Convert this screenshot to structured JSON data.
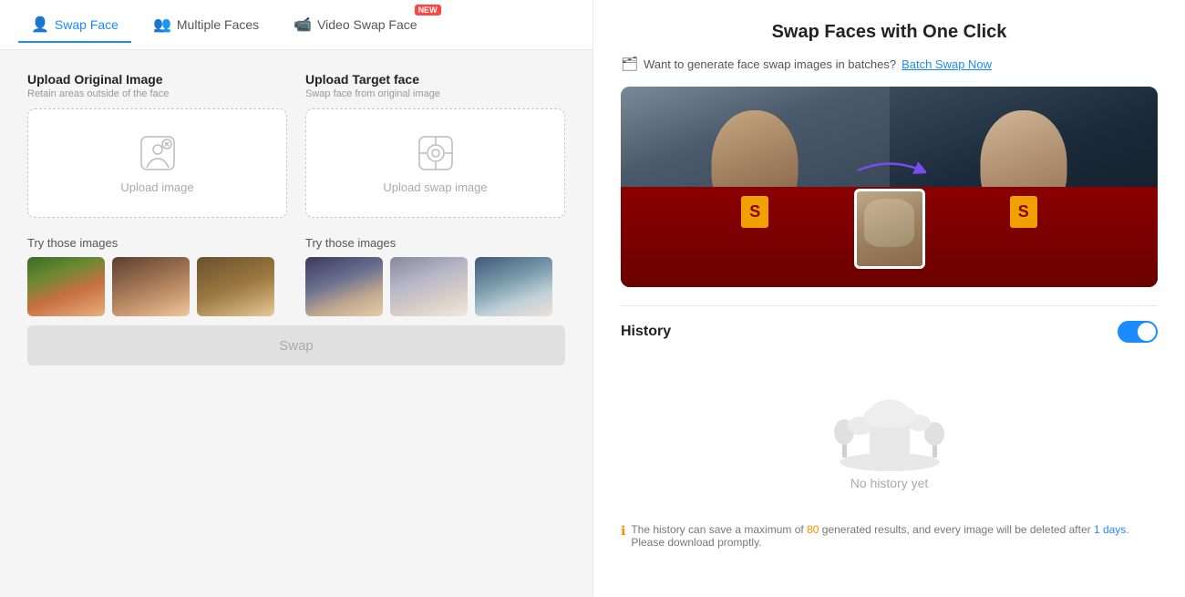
{
  "tabs": [
    {
      "id": "swap-face",
      "label": "Swap Face",
      "icon": "👤",
      "active": true,
      "new": false
    },
    {
      "id": "multiple-faces",
      "label": "Multiple Faces",
      "icon": "👥",
      "active": false,
      "new": false
    },
    {
      "id": "video-swap",
      "label": "Video Swap Face",
      "icon": "🎬",
      "active": false,
      "new": true
    }
  ],
  "upload_original": {
    "title": "Upload Original Image",
    "subtitle": "Retain areas outside of the face",
    "label": "Upload image"
  },
  "upload_target": {
    "title": "Upload Target face",
    "subtitle": "Swap face from original image",
    "label": "Upload swap image"
  },
  "sample_images": {
    "label": "Try those images"
  },
  "swap_button": {
    "label": "Swap"
  },
  "right_panel": {
    "title": "Swap Faces with One Click",
    "batch_text": "Want to generate face swap images in batches?",
    "batch_link": "Batch Swap Now"
  },
  "history": {
    "title": "History",
    "empty_text": "No history yet",
    "note_prefix": "The history can save a maximum of ",
    "note_number": "80",
    "note_mid": " generated results, and every image will be deleted after ",
    "note_days": "1 days",
    "note_suffix": ". Please download promptly."
  }
}
